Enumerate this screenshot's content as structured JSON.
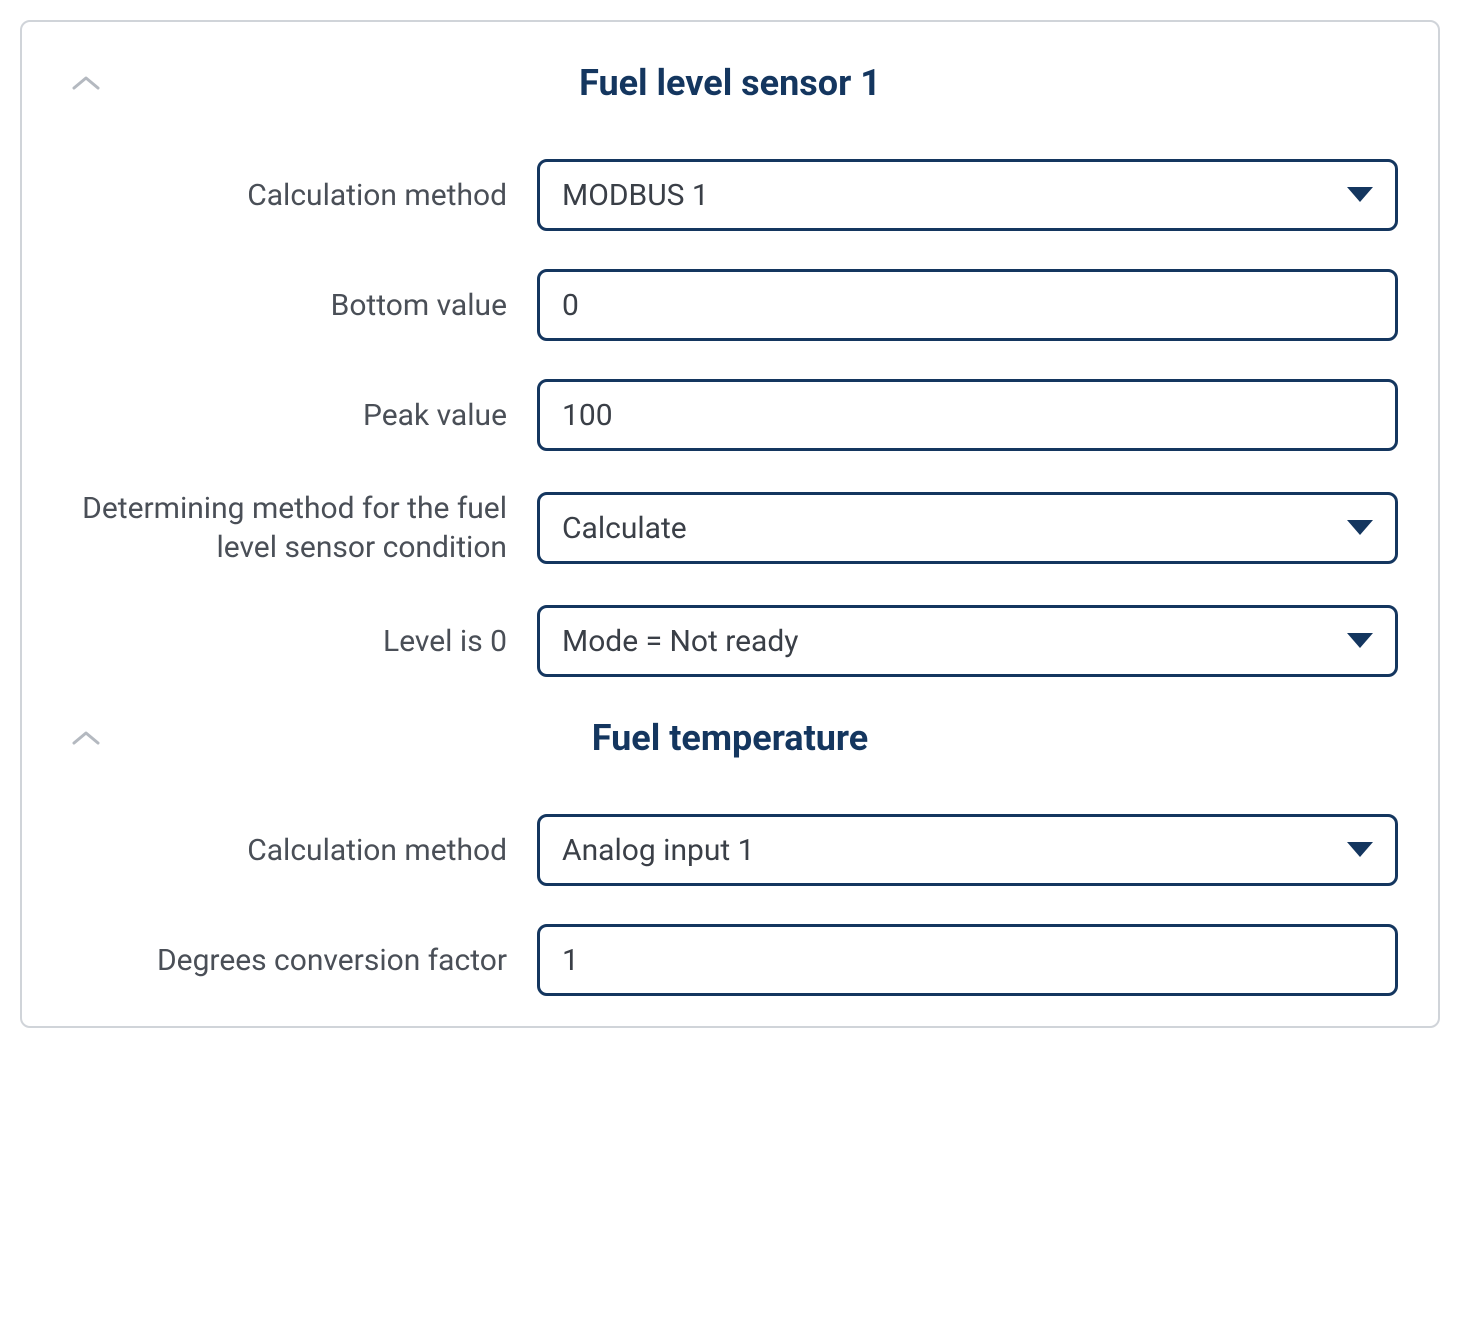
{
  "sections": {
    "fuel_sensor": {
      "title": "Fuel level sensor 1",
      "fields": {
        "calc_method": {
          "label": "Calculation method",
          "value": "MODBUS 1"
        },
        "bottom_value": {
          "label": "Bottom value",
          "value": "0"
        },
        "peak_value": {
          "label": "Peak value",
          "value": "100"
        },
        "determining_method": {
          "label": "Determining method for the fuel level sensor condition",
          "value": "Calculate"
        },
        "level_zero": {
          "label": "Level is 0",
          "value": "Mode = Not ready"
        }
      }
    },
    "fuel_temp": {
      "title": "Fuel temperature",
      "fields": {
        "calc_method": {
          "label": "Calculation method",
          "value": "Analog input 1"
        },
        "degrees_factor": {
          "label": "Degrees conversion factor",
          "value": "1"
        }
      }
    }
  }
}
